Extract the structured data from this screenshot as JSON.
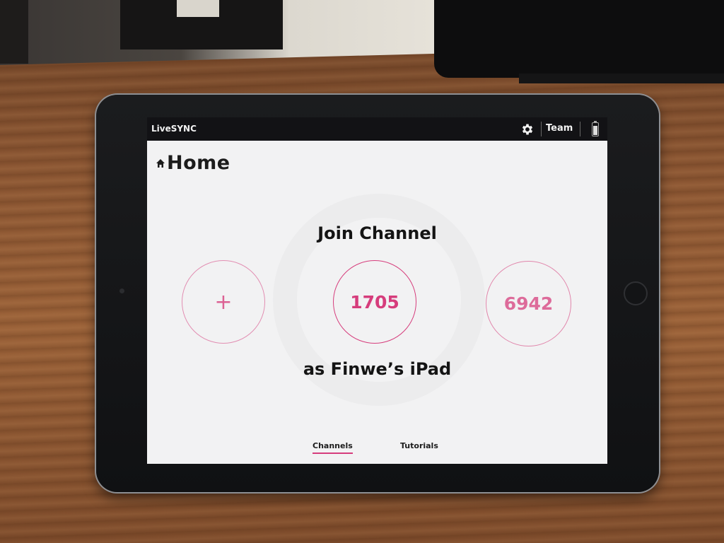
{
  "statusbar": {
    "app_name": "LiveSYNC",
    "settings_icon": "gear-icon",
    "team_label": "Team",
    "battery_icon": "battery-icon",
    "battery_level": 0.8
  },
  "page": {
    "home_icon": "house-icon",
    "title": "Home"
  },
  "main": {
    "heading": "Join Channel",
    "channels": [
      {
        "label": "+",
        "icon": "plus-icon"
      },
      {
        "label": "1705"
      },
      {
        "label": "6942"
      }
    ],
    "subheading": "as Finwe’s iPad"
  },
  "tabs": [
    {
      "label": "Channels",
      "active": true
    },
    {
      "label": "Tutorials",
      "active": false
    }
  ],
  "colors": {
    "accent": "#d63d7c",
    "statusbar_bg": "#121215",
    "screen_bg": "#f2f2f3"
  }
}
